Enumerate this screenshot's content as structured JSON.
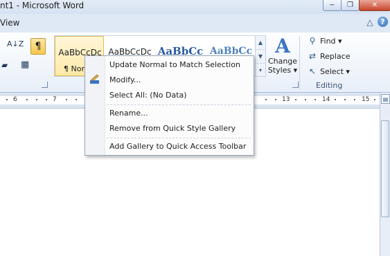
{
  "window": {
    "title": "nt1 - Microsoft Word",
    "controls": {
      "minimize": "−",
      "restore": "❐",
      "close": "✕"
    }
  },
  "tabs": {
    "view_label": "View",
    "help_glyph": "?",
    "collapse_glyph": "△"
  },
  "ribbon": {
    "paragraph": {
      "sort_glyph": "A↓Z",
      "show_marks_glyph": "¶"
    },
    "styles": {
      "tiles": [
        {
          "preview": "AaBbCcDc",
          "name": "¶ Normal"
        },
        {
          "preview": "AaBbCcDc",
          "name": ""
        },
        {
          "preview": "AaBbCc",
          "name": ""
        },
        {
          "preview": "AaBbCc",
          "name": ""
        }
      ],
      "change_styles_glyph": "A",
      "change_styles_label_1": "Change",
      "change_styles_label_2": "Styles ▾"
    },
    "editing": {
      "find_label": "Find ▾",
      "replace_label": "Replace",
      "select_label": "Select ▾",
      "group_label": "Editing"
    }
  },
  "ruler": {
    "numbers": [
      "6",
      "7",
      "13",
      "14",
      "15"
    ]
  },
  "context_menu": {
    "items": [
      "Update Normal to Match Selection",
      "Modify...",
      "Select All: (No Data)",
      "Rename...",
      "Remove from Quick Style Gallery",
      "Add Gallery to Quick Access Toolbar"
    ]
  },
  "colors": {
    "ribbon_bg": "#e8eff8",
    "selected_style": "#fde9a8",
    "accent_blue": "#3a74c4",
    "menu_bg": "#fcfcfd"
  }
}
